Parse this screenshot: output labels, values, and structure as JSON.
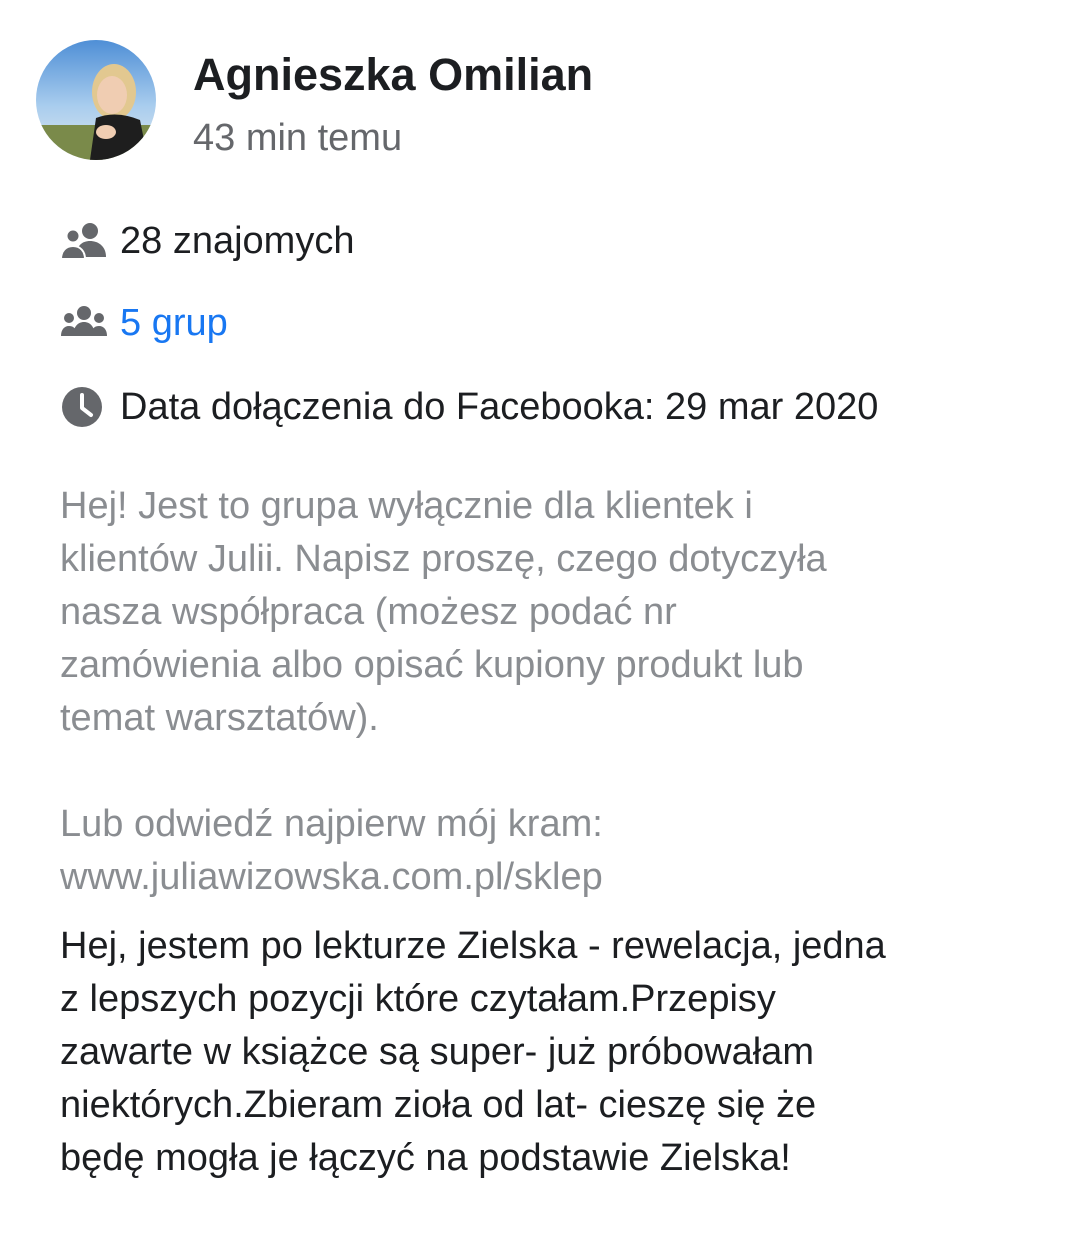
{
  "profile": {
    "name": "Agnieszka Omilian",
    "time": "43 min temu"
  },
  "info": {
    "friends": {
      "icon": "friends-icon",
      "label": "28 znajomych"
    },
    "groups": {
      "icon": "groups-icon",
      "label": "5 grup"
    },
    "joined": {
      "icon": "clock-icon",
      "label": "Data dołączenia do Facebooka: 29 mar 2020"
    }
  },
  "membership_answer": {
    "lines": [
      "Hej! Jest to grupa wyłącznie dla klientek i",
      "klientów Julii. Napisz proszę, czego dotyczyła",
      "nasza współpraca (możesz podać nr",
      "zamówienia albo opisać kupiony produkt lub",
      "temat warsztatów)."
    ],
    "lines2": [
      "Lub odwiedź najpierw mój kram:",
      "www.juliawizowska.com.pl/sklep"
    ]
  },
  "comment": {
    "lines": [
      "Hej, jestem po lekturze Zielska - rewelacja, jedna",
      "z lepszych pozycji które czytałam.Przepisy",
      "zawarte w książce są super- już próbowałam",
      "niektórych.Zbieram zioła od lat- cieszę się że",
      "będę mogła je łączyć na podstawie Zielska!"
    ]
  },
  "colors": {
    "primary_text": "#1c1e21",
    "secondary_text": "#65676b",
    "muted_text": "#8a8d91",
    "link": "#1877f2",
    "icon": "#65676b"
  }
}
